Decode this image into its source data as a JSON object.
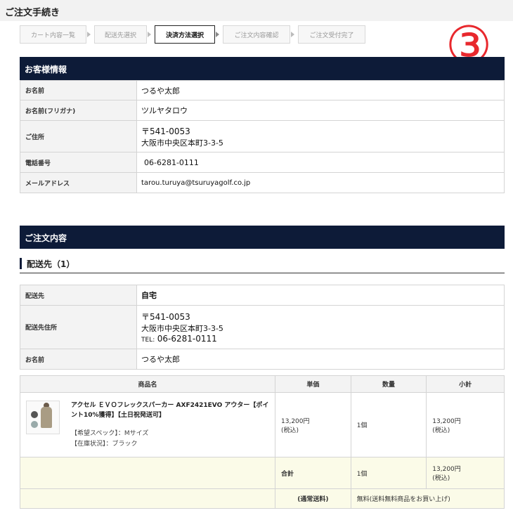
{
  "page_title": "ご注文手続き",
  "steps": [
    "カート内容一覧",
    "配送先選択",
    "決済方法選択",
    "ご注文内容確認",
    "ご注文受付完了"
  ],
  "active_step": 2,
  "step_number": "③",
  "customer": {
    "heading": "お客様情報",
    "name_label": "お名前",
    "name": "つるや太郎",
    "kana_label": "お名前(フリガナ)",
    "kana": "ツルヤタロウ",
    "address_label": "ご住所",
    "postal": "〒541-0053",
    "address": "大阪市中央区本町3-3-5",
    "phone_label": "電話番号",
    "phone": "06-6281-0111",
    "email_label": "メールアドレス",
    "email": "tarou.turuya@tsuruyagolf.co.jp"
  },
  "order": {
    "heading": "ご注文内容",
    "destination_heading": "配送先（1）",
    "dest_label": "配送先",
    "dest": "自宅",
    "dest_addr_label": "配送先住所",
    "dest_postal": "〒541-0053",
    "dest_address": "大阪市中央区本町3-3-5",
    "dest_tel_prefix": "TEL:",
    "dest_tel": "06-6281-0111",
    "dest_name_label": "お名前",
    "dest_name": "つるや太郎"
  },
  "items_table": {
    "headers": [
      "商品名",
      "単価",
      "数量",
      "小計"
    ],
    "product_name": "アクセル ＥＶＯフレックスパーカー AXF2421EVO アウター【ポイント10%獲得】【土日祝発送可】",
    "spec": "【希望スペック】：Mサイズ",
    "stock": "【在庫状況】：ブラック",
    "unit_price": "13,200円",
    "tax_note": "(税込)",
    "qty": "1個",
    "subtotal": "13,200円",
    "total_label": "合計",
    "total_qty": "1個",
    "total_price": "13,200円",
    "shipping_label": "(通常送料)",
    "shipping_value": "無料(送料無料商品をお買い上げ)"
  }
}
